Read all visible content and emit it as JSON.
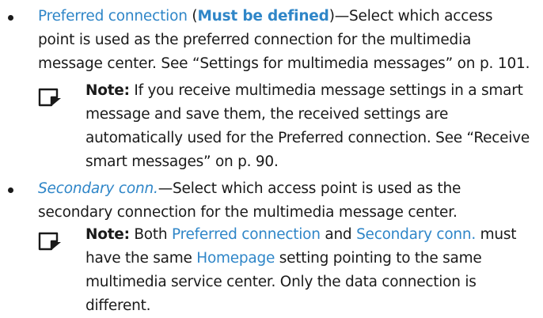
{
  "items": [
    {
      "link": "Preferred connection",
      "paren_open": " (",
      "bold": "Must be defined",
      "paren_close": ")",
      "body": "—Select which access point is used as the preferred connection for the multimedia message center. See “Settings for multimedia messages” on p. 101.",
      "note": {
        "label": "Note:",
        "text": " If you receive multimedia message settings in a smart message and save them, the received settings are automatically used for the Preferred connection. See “Receive smart messages” on p. 90."
      }
    },
    {
      "link": "Secondary conn.",
      "body": "—Select which access point is used as the secondary connection for the multimedia message center.",
      "note": {
        "label": "Note:",
        "t1": " Both ",
        "link1": "Preferred connection",
        "t2": " and ",
        "link2": "Secondary conn.",
        "t3": " must have the same ",
        "link3": "Homepage",
        "t4": " setting pointing to the same multimedia service center. Only the data connection is different."
      }
    }
  ],
  "icons": [
    "note-icon"
  ]
}
